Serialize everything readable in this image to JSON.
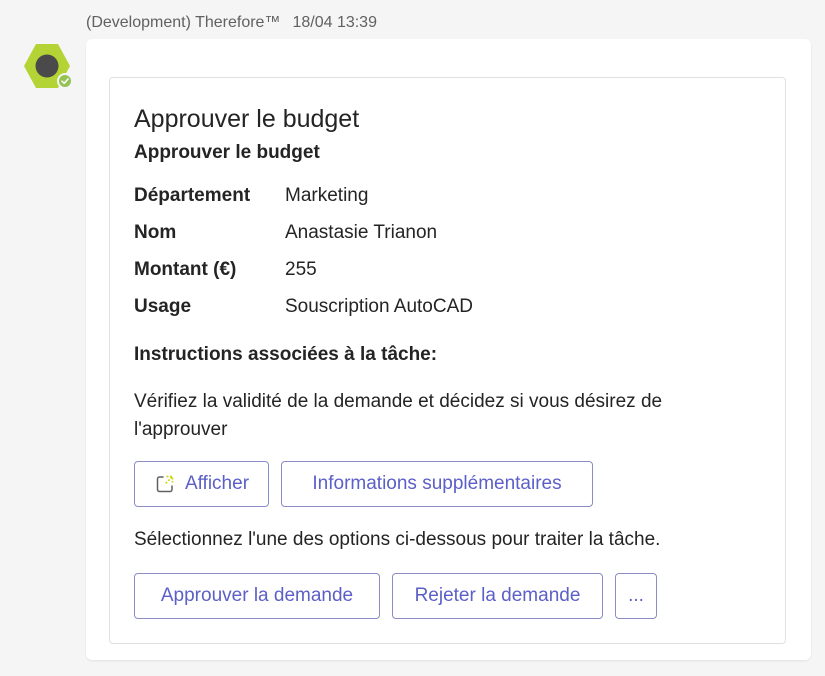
{
  "message": {
    "sender": "(Development) Therefore™",
    "time": "18/04 13:39"
  },
  "avatar": {
    "shape_color": "#b4d334",
    "center_color": "#4a4a4a",
    "status_color": "#92c353"
  },
  "card": {
    "title": "Approuver le budget",
    "subtitle": "Approuver le budget",
    "facts": [
      {
        "key": "Département",
        "value": "Marketing"
      },
      {
        "key": "Nom",
        "value": "Anastasie Trianon"
      },
      {
        "key": "Montant (€)",
        "value": "255"
      },
      {
        "key": "Usage",
        "value": "Souscription AutoCAD"
      }
    ],
    "instructions_title": "Instructions associées à la tâche:",
    "instructions_text": "Vérifiez la validité de la demande et décidez si vous désirez de l'approuver",
    "action_buttons": {
      "view_label": "Afficher",
      "more_info_label": "Informations supplémentaires"
    },
    "select_prompt": "Sélectionnez l'une des options ci-dessous pour traiter la tâche.",
    "decision_buttons": {
      "approve_label": "Approuver la demande",
      "reject_label": "Rejeter la demande",
      "more_label": "..."
    }
  },
  "colors": {
    "accent": "#5b5fc7",
    "button_border": "#8b8cc7",
    "card_border": "#e0e0e0"
  }
}
